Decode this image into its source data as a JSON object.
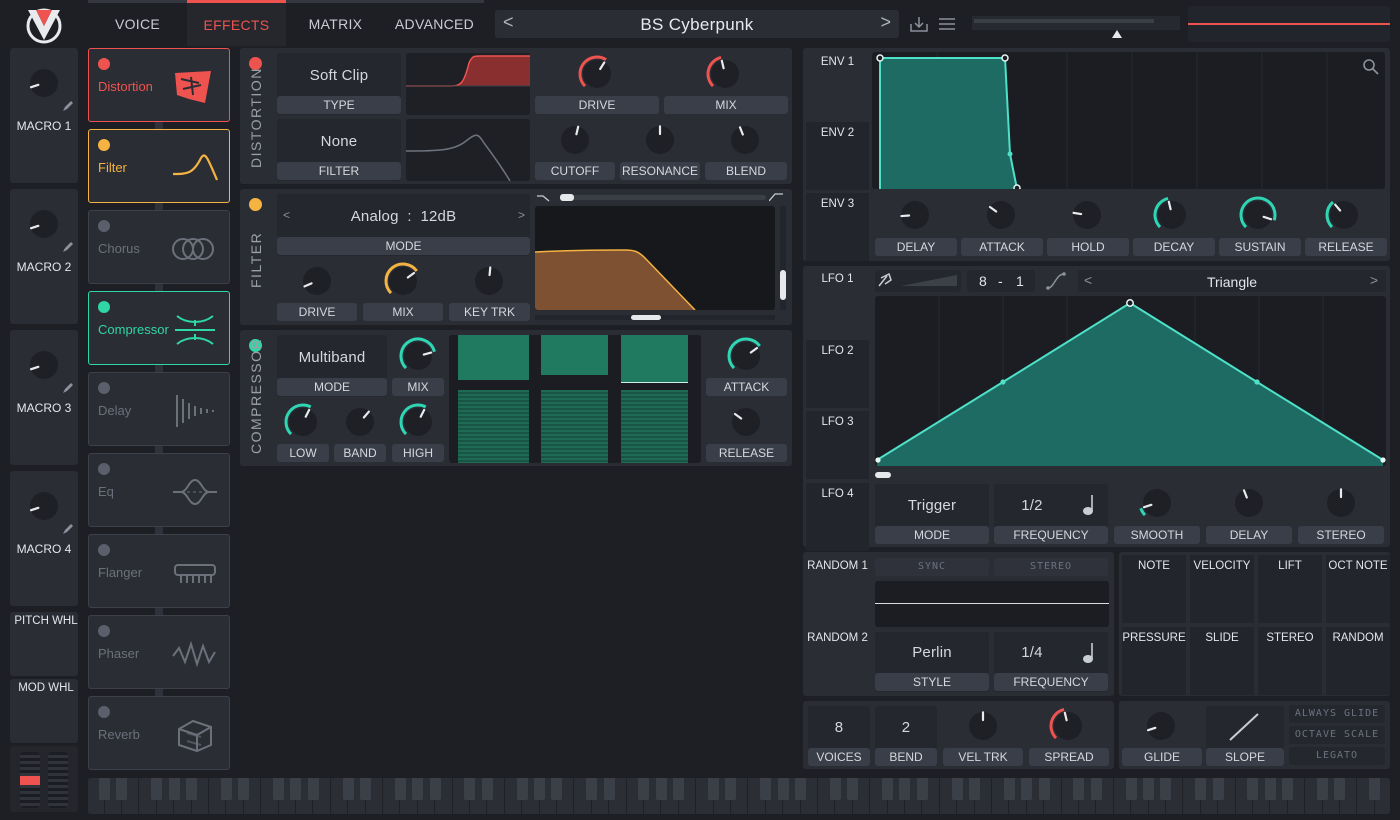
{
  "header": {
    "tabs": [
      "VOICE",
      "EFFECTS",
      "MATRIX",
      "ADVANCED"
    ],
    "active_tab": "EFFECTS",
    "preset_name": "BS Cyberpunk",
    "prev_symbol": "<",
    "next_symbol": ">"
  },
  "macros": [
    "MACRO 1",
    "MACRO 2",
    "MACRO 3",
    "MACRO 4"
  ],
  "wheels": {
    "pitch": "PITCH WHL",
    "mod": "MOD WHL"
  },
  "effects_list": [
    {
      "name": "Distortion",
      "on": true,
      "color": "#ef5350",
      "icon": "distortion-icon"
    },
    {
      "name": "Filter",
      "on": true,
      "color": "#f5b342",
      "icon": "filter-icon"
    },
    {
      "name": "Chorus",
      "on": false,
      "color": "#5a5f6b",
      "icon": "chorus-icon"
    },
    {
      "name": "Compressor",
      "on": true,
      "color": "#2fd6a6",
      "icon": "compressor-icon"
    },
    {
      "name": "Delay",
      "on": false,
      "color": "#5a5f6b",
      "icon": "delay-icon"
    },
    {
      "name": "Eq",
      "on": false,
      "color": "#5a5f6b",
      "icon": "eq-icon"
    },
    {
      "name": "Flanger",
      "on": false,
      "color": "#5a5f6b",
      "icon": "flanger-icon"
    },
    {
      "name": "Phaser",
      "on": false,
      "color": "#5a5f6b",
      "icon": "phaser-icon"
    },
    {
      "name": "Reverb",
      "on": false,
      "color": "#5a5f6b",
      "icon": "reverb-icon"
    }
  ],
  "distortion": {
    "section": "DISTORTION",
    "type_value": "Soft Clip",
    "type_label": "TYPE",
    "filter_value": "None",
    "filter_label": "FILTER",
    "knobs": [
      "DRIVE",
      "MIX",
      "CUTOFF",
      "RESONANCE",
      "BLEND"
    ]
  },
  "filter": {
    "section": "FILTER",
    "mode_value": "Analog  :  12dB",
    "mode_label": "MODE",
    "knobs": [
      "DRIVE",
      "MIX",
      "KEY TRK"
    ]
  },
  "compressor": {
    "section": "COMPRESSOR",
    "mode_value": "Multiband",
    "mode_label": "MODE",
    "knobs": [
      "MIX",
      "LOW",
      "BAND",
      "HIGH",
      "ATTACK",
      "RELEASE"
    ]
  },
  "envelopes": {
    "slots": [
      "ENV 1",
      "ENV 2",
      "ENV 3"
    ],
    "knobs": [
      "DELAY",
      "ATTACK",
      "HOLD",
      "DECAY",
      "SUSTAIN",
      "RELEASE"
    ]
  },
  "lfos": {
    "slots": [
      "LFO 1",
      "LFO 2",
      "LFO 3",
      "LFO 4"
    ],
    "rate_a": "8",
    "rate_sep": "-",
    "rate_b": "1",
    "shape": "Triangle",
    "mode_value": "Trigger",
    "mode_label": "MODE",
    "freq_value": "1/2",
    "freq_label": "FREQUENCY",
    "knobs": [
      "SMOOTH",
      "DELAY",
      "STEREO"
    ]
  },
  "random": {
    "slots": [
      "RANDOM 1",
      "RANDOM 2"
    ],
    "sync_label": "SYNC",
    "stereo_label": "STEREO",
    "style_value": "Perlin",
    "style_label": "STYLE",
    "freq_value": "1/4",
    "freq_label": "FREQUENCY"
  },
  "sources": [
    "NOTE",
    "VELOCITY",
    "LIFT",
    "OCT NOTE",
    "PRESSURE",
    "SLIDE",
    "STEREO",
    "RANDOM"
  ],
  "voice": {
    "voices_value": "8",
    "voices_label": "VOICES",
    "bend_value": "2",
    "bend_label": "BEND",
    "veltrk_label": "VEL TRK",
    "spread_label": "SPREAD",
    "glide_label": "GLIDE",
    "slope_label": "SLOPE",
    "options": [
      "ALWAYS GLIDE",
      "OCTAVE SCALE",
      "LEGATO"
    ]
  },
  "colors": {
    "accent": "#2fd6b4",
    "distortion": "#ef5350",
    "filter": "#f5b342",
    "panel": "#2a2d34"
  }
}
